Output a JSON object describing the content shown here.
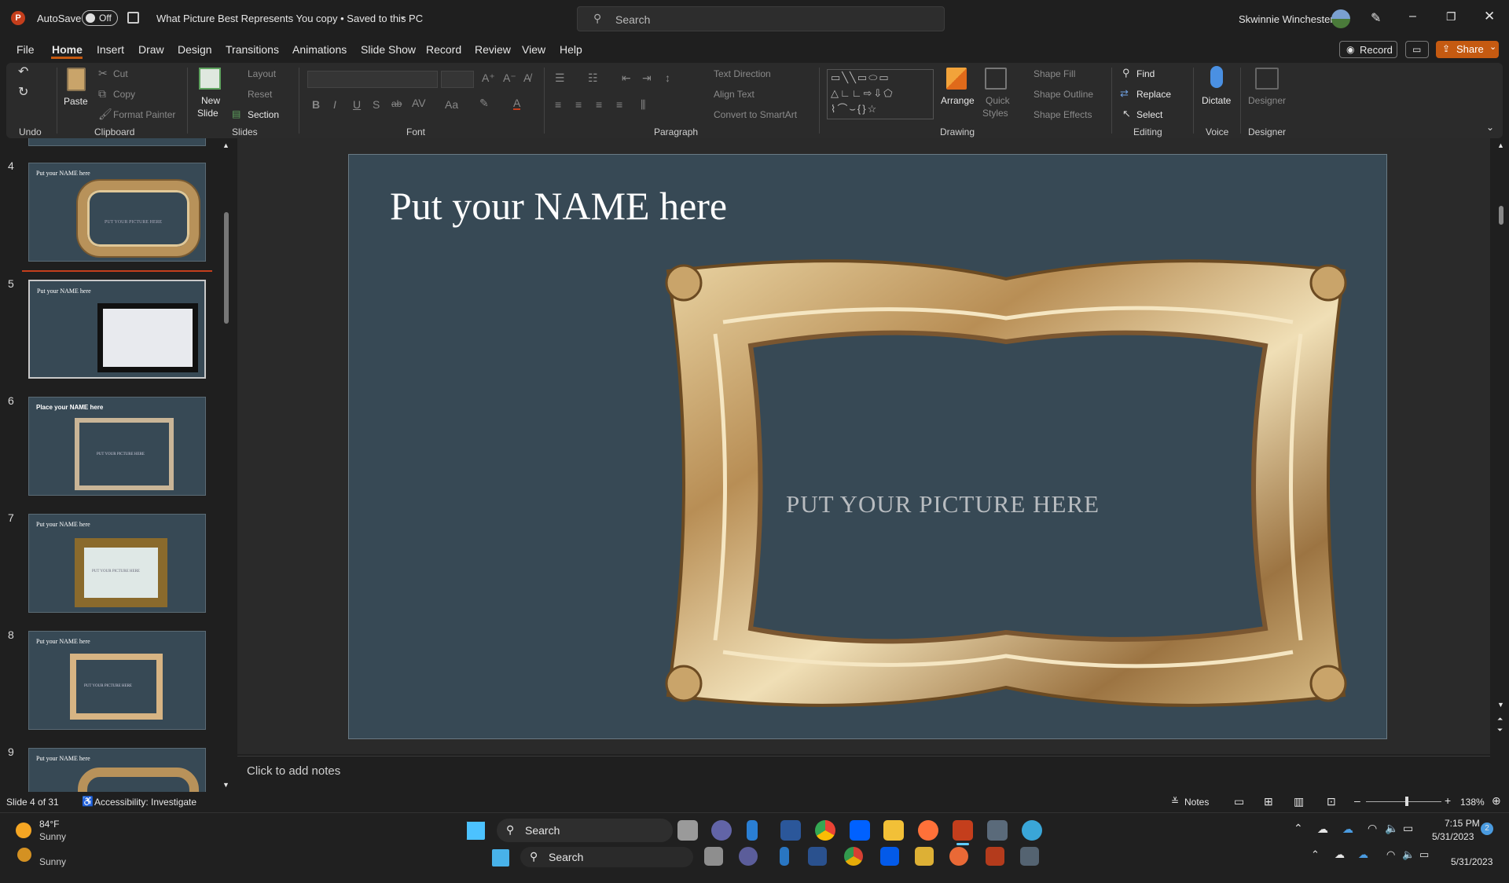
{
  "title_bar": {
    "autosave_label": "AutoSave",
    "autosave_state": "Off",
    "document_title": "What Picture Best Represents You copy  •  Saved to this PC",
    "search_placeholder": "Search",
    "user_name": "Skwinnie Winchester"
  },
  "menu": {
    "tabs": [
      "File",
      "Home",
      "Insert",
      "Draw",
      "Design",
      "Transitions",
      "Animations",
      "Slide Show",
      "Record",
      "Review",
      "View",
      "Help"
    ],
    "active_tab": "Home",
    "record_button": "Record",
    "share_button": "Share"
  },
  "ribbon": {
    "groups": {
      "undo": "Undo",
      "clipboard": "Clipboard",
      "slides": "Slides",
      "font": "Font",
      "paragraph": "Paragraph",
      "drawing": "Drawing",
      "editing": "Editing",
      "voice": "Voice",
      "designer": "Designer"
    },
    "clipboard": {
      "paste": "Paste",
      "cut": "Cut",
      "copy": "Copy",
      "format_painter": "Format Painter"
    },
    "slides": {
      "new_slide_1": "New",
      "new_slide_2": "Slide",
      "layout": "Layout",
      "reset": "Reset",
      "section": "Section"
    },
    "paragraph": {
      "text_direction": "Text Direction",
      "align_text": "Align Text",
      "convert_smartart": "Convert to SmartArt"
    },
    "drawing": {
      "arrange": "Arrange",
      "quick_styles_1": "Quick",
      "quick_styles_2": "Styles",
      "shape_fill": "Shape Fill",
      "shape_outline": "Shape Outline",
      "shape_effects": "Shape Effects"
    },
    "editing": {
      "find": "Find",
      "replace": "Replace",
      "select": "Select"
    },
    "voice": {
      "dictate": "Dictate"
    },
    "designer": {
      "designer": "Designer"
    },
    "font_buttons": {
      "bold": "B",
      "italic": "I",
      "underline": "U",
      "shadow": "S",
      "strike": "ab"
    }
  },
  "thumbnails": [
    {
      "number": "4",
      "title": "Put your NAME here",
      "caption": "PUT YOUR PICTURE HERE"
    },
    {
      "number": "5",
      "title": "Put your NAME here",
      "caption": ""
    },
    {
      "number": "6",
      "title": "Place your NAME here",
      "caption": "PUT YOUR PICTURE HERE"
    },
    {
      "number": "7",
      "title": "Put your NAME here",
      "caption": "PUT YOUR PICTURE HERE"
    },
    {
      "number": "8",
      "title": "Put your NAME here",
      "caption": "PUT YOUR PICTURE HERE"
    },
    {
      "number": "9",
      "title": "Put your NAME here",
      "caption": ""
    }
  ],
  "slide": {
    "title": "Put your NAME here",
    "placeholder": "PUT YOUR PICTURE HERE",
    "background_color": "#374955"
  },
  "notes": {
    "placeholder": "Click to add notes"
  },
  "status": {
    "slide_info": "Slide 4 of 31",
    "accessibility": "Accessibility: Investigate",
    "notes_button": "Notes",
    "zoom": "138%"
  },
  "taskbar": {
    "weather_temp": "84°F",
    "weather_desc": "Sunny",
    "search_label": "Search",
    "time": "7:15 PM",
    "date": "5/31/2023",
    "notification_count": "2",
    "ghost_weather": "Sunny",
    "ghost_search": "Search",
    "ghost_date": "5/31/2023"
  },
  "colors": {
    "accent_orange": "#c55a11",
    "slide_bg": "#374955",
    "powerpoint_red": "#c43e1c"
  }
}
